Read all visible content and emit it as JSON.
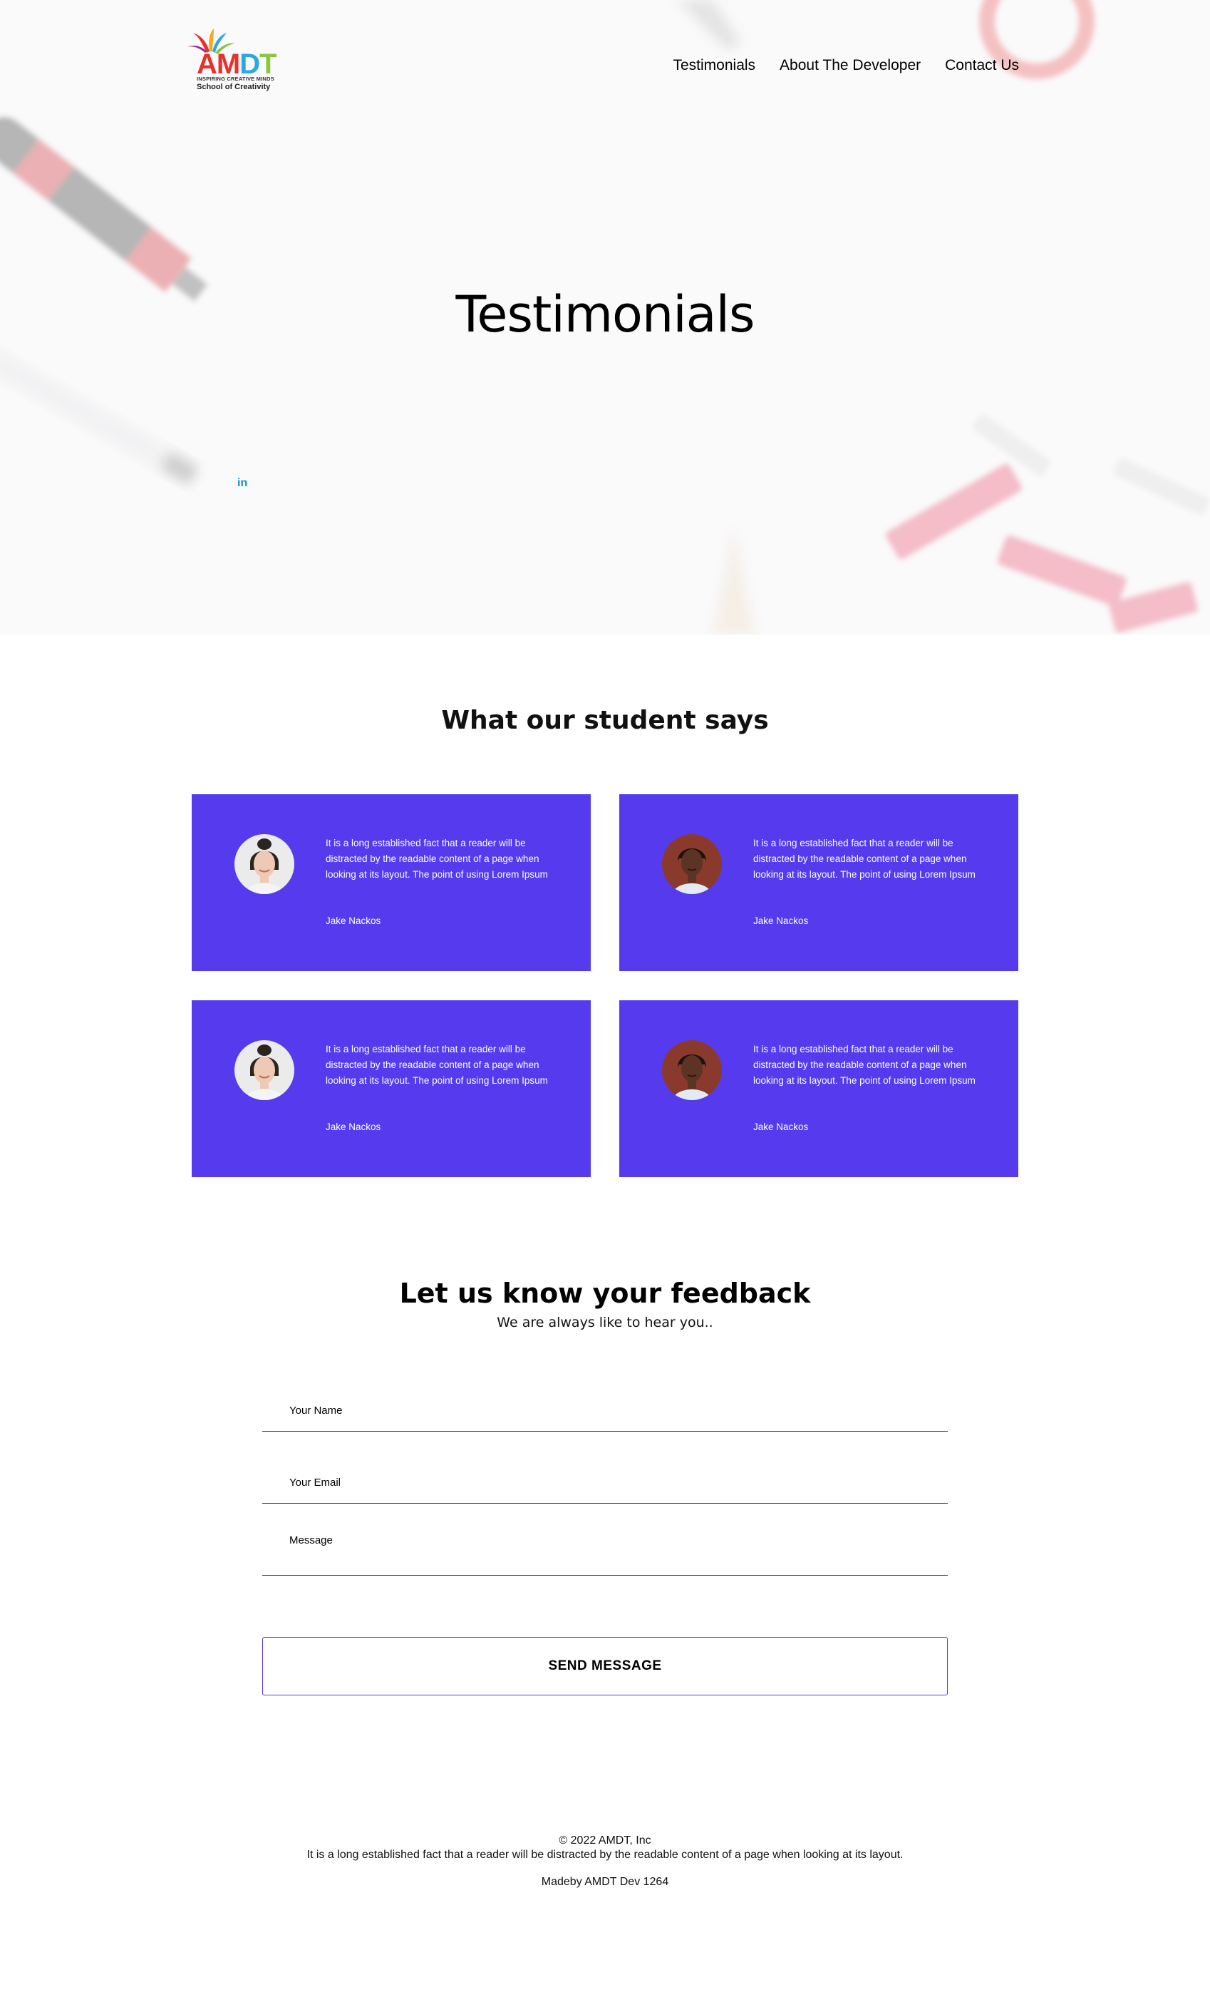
{
  "header": {
    "logo": {
      "wordmark": [
        "A",
        "M",
        "D",
        "T"
      ],
      "tagline": "INSPIRING CREATIVE MINDS",
      "subtitle": "School of Creativity"
    },
    "nav": [
      {
        "label": "Testimonials"
      },
      {
        "label": "About The Developer"
      },
      {
        "label": "Contact Us"
      }
    ]
  },
  "hero": {
    "title": "Testimonials",
    "social_icon": "linkedin-icon",
    "social_label": "in"
  },
  "testimonials": {
    "title": "What our student says",
    "items": [
      {
        "quote": "It is a long established fact that a reader will be distracted by the readable content of a page when looking at its layout. The point of using Lorem Ipsum",
        "author": "Jake Nackos",
        "avatar": "woman-light-avatar"
      },
      {
        "quote": "It is a long established fact that a reader will be distracted by the readable content of a page when looking at its layout. The point of using Lorem Ipsum",
        "author": "Jake Nackos",
        "avatar": "woman-dark-avatar"
      },
      {
        "quote": "It is a long established fact that a reader will be distracted by the readable content of a page when looking at its layout. The point of using Lorem Ipsum",
        "author": "Jake Nackos",
        "avatar": "woman-light-avatar"
      },
      {
        "quote": "It is a long established fact that a reader will be distracted by the readable content of a page when looking at its layout. The point of using Lorem Ipsum",
        "author": "Jake Nackos",
        "avatar": "woman-dark-avatar"
      }
    ]
  },
  "feedback": {
    "title": "Let us know your feedback",
    "subtitle": "We are always like to hear you..",
    "fields": {
      "name": {
        "placeholder": "Your Name",
        "value": ""
      },
      "email": {
        "placeholder": "Your Email",
        "value": ""
      },
      "message": {
        "placeholder": "Message",
        "value": ""
      }
    },
    "send_label": "SEND MESSAGE"
  },
  "footer": {
    "copyright": "© 2022 AMDT, Inc",
    "description": "It is a long established fact that a reader will be distracted by the readable content of a page when looking at its layout.",
    "made_by": "Madeby AMDT Dev 1264"
  },
  "colors": {
    "card_background": "#553bed",
    "button_border": "#553bed",
    "linkedin": "#1a8fd6"
  }
}
